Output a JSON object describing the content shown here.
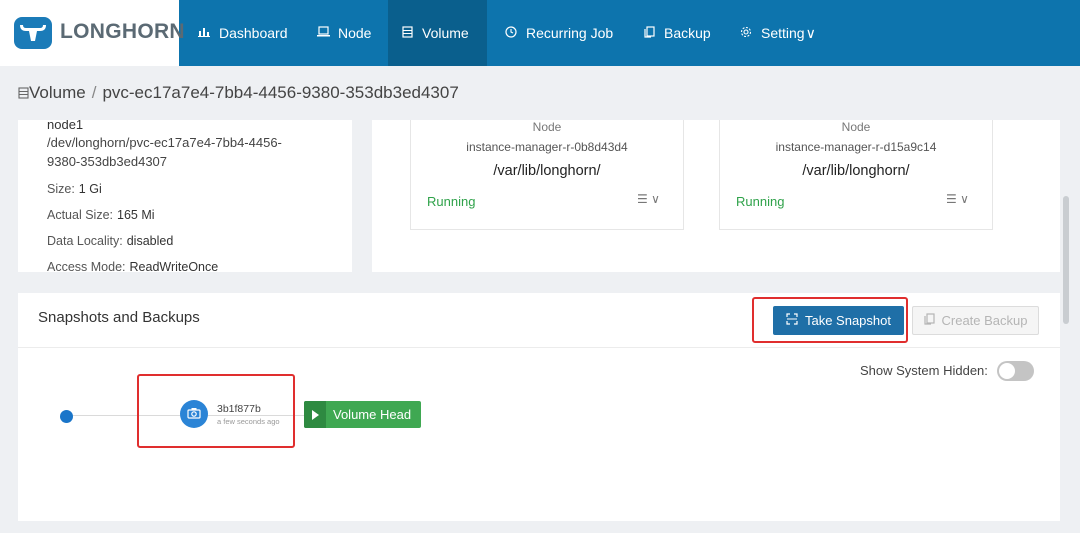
{
  "app": {
    "logo_text": "LONGHORN"
  },
  "nav": [
    {
      "label": "Dashboard",
      "icon": "chart-icon"
    },
    {
      "label": "Node",
      "icon": "laptop-icon"
    },
    {
      "label": "Volume",
      "icon": "volume-icon",
      "active": true
    },
    {
      "label": "Recurring Job",
      "icon": "clock-icon"
    },
    {
      "label": "Backup",
      "icon": "copy-icon"
    },
    {
      "label": "Setting",
      "icon": "gear-icon",
      "suffix": "∨"
    }
  ],
  "breadcrumb": {
    "root": "Volume",
    "separator": "/",
    "current": "pvc-ec17a7e4-7bb4-4456-9380-353db3ed4307"
  },
  "volume_info": {
    "node": "node1",
    "device_line1": "/dev/longhorn/pvc-ec17a7e4-7bb4-4456-",
    "device_line2": "9380-353db3ed4307",
    "size_label": "Size:",
    "size": "1 Gi",
    "actual_size_label": "Actual Size:",
    "actual_size": "165 Mi",
    "data_locality_label": "Data Locality:",
    "data_locality": "disabled",
    "access_mode_label": "Access Mode:",
    "access_mode": "ReadWriteOnce"
  },
  "replicas": [
    {
      "node_label": "Node",
      "instance_manager": "instance-manager-r-0b8d43d4",
      "path": "/var/lib/longhorn/",
      "status": "Running",
      "menu": "☰ ∨"
    },
    {
      "node_label": "Node",
      "instance_manager": "instance-manager-r-d15a9c14",
      "path": "/var/lib/longhorn/",
      "status": "Running",
      "menu": "☰ ∨"
    }
  ],
  "snapshots": {
    "title": "Snapshots and Backups",
    "take_snapshot_label": "Take Snapshot",
    "create_backup_label": "Create Backup",
    "show_hidden_label": "Show System Hidden:",
    "show_hidden_on": false,
    "snapshot_name": "3b1f877b",
    "snapshot_time": "a few seconds ago",
    "volume_head_label": "Volume Head"
  },
  "colors": {
    "nav_bg": "#0d74ad",
    "nav_active": "#0a5f8d",
    "primary_button": "#1f6fa7",
    "running": "#2fa24a",
    "volume_head": "#3fa852",
    "highlight_box": "#e02e2e"
  }
}
